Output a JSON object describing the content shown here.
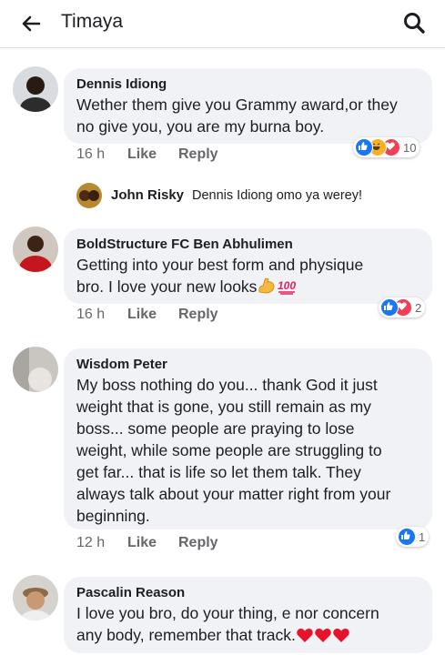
{
  "header": {
    "title": "Timaya"
  },
  "comments": [
    {
      "author": "Dennis Idiong",
      "lines": [
        "Wether them give you Grammy award,or they",
        "no give you, you are my burna boy."
      ],
      "time": "16 h",
      "like": "Like",
      "reply": "Reply",
      "reactions": [
        "like",
        "haha",
        "love"
      ],
      "reaction_count": "10"
    },
    {
      "author": "BoldStructure FC Ben Abhulimen",
      "lines": [
        "Getting into your best form and physique",
        "bro. I love your new looks"
      ],
      "time": "16 h",
      "like": "Like",
      "reply": "Reply",
      "reactions": [
        "like",
        "love"
      ],
      "reaction_count": "2"
    },
    {
      "author": "Wisdom Peter",
      "lines": [
        "My boss nothing do you... thank God it just",
        "weight that is gone, you still remain  as my",
        "boss... some people are praying to lose",
        "weight, while some people are struggling to",
        "get far... that is life so let them talk. They",
        "always talk about your matter right from your",
        "beginning."
      ],
      "time": "12 h",
      "like": "Like",
      "reply": "Reply",
      "reactions": [
        "like"
      ],
      "reaction_count": "1"
    },
    {
      "author": "Pascalin Reason",
      "lines": [
        "I love you bro, do your thing, e nor concern",
        "any body, remember that track."
      ]
    }
  ],
  "reply_preview": {
    "author": "John Risky",
    "text": "Dennis Idiong omo ya werey!"
  },
  "icons": {
    "back": "arrow-left-icon",
    "search": "magnifier-icon",
    "like_reaction": "thumbs-up-icon",
    "love_reaction": "heart-icon",
    "haha_reaction": "laughing-face-icon"
  },
  "colors": {
    "like": "#1877f2",
    "love": "#f33e58",
    "haha": "#f7b125",
    "meta": "#65676b",
    "bubble": "#f0f2f5"
  }
}
